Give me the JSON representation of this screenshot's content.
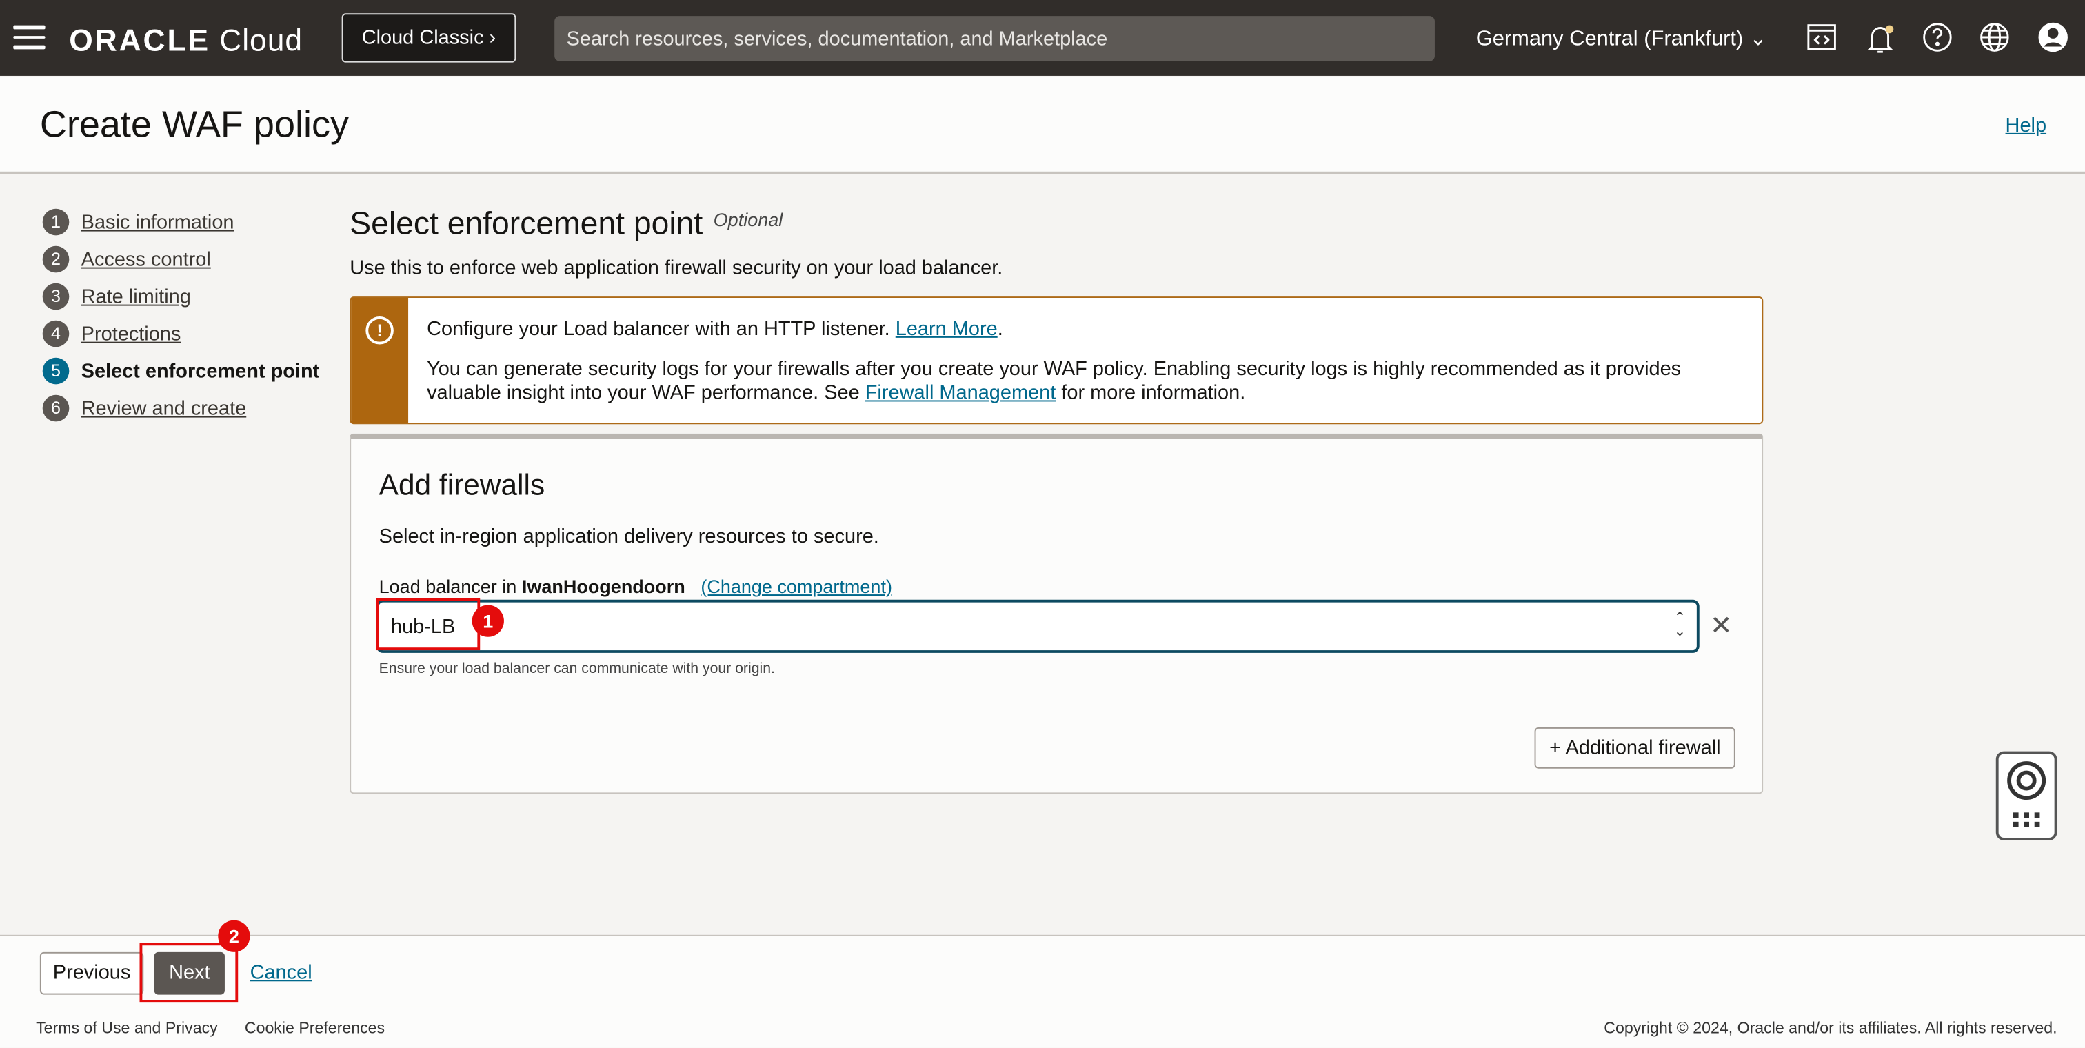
{
  "header": {
    "logo_text": "ORACLE",
    "logo_cloud": "Cloud",
    "classic_button": "Cloud Classic ›",
    "search_placeholder": "Search resources, services, documentation, and Marketplace",
    "region": "Germany Central (Frankfurt)"
  },
  "page": {
    "title": "Create WAF policy",
    "help": "Help"
  },
  "steps": [
    {
      "num": "1",
      "label": "Basic information"
    },
    {
      "num": "2",
      "label": "Access control"
    },
    {
      "num": "3",
      "label": "Rate limiting"
    },
    {
      "num": "4",
      "label": "Protections"
    },
    {
      "num": "5",
      "label": "Select enforcement point"
    },
    {
      "num": "6",
      "label": "Review and create"
    }
  ],
  "section": {
    "title": "Select enforcement point",
    "optional": "Optional",
    "description": "Use this to enforce web application firewall security on your load balancer."
  },
  "alert": {
    "line1": "Configure your Load balancer with an HTTP listener.",
    "learn_more": "Learn More",
    "line2a": "You can generate security logs for your firewalls after you create your WAF policy. Enabling security logs is highly recommended as it provides valuable insight into your WAF performance. See",
    "firewall_link": "Firewall Management",
    "line2b": "for more information."
  },
  "card": {
    "title": "Add firewalls",
    "description": "Select in-region application delivery resources to secure.",
    "lb_label": "Load balancer in",
    "compartment": "IwanHoogendoorn",
    "change_compartment": "(Change compartment)",
    "selected": "hub-LB",
    "hint": "Ensure your load balancer can communicate with your origin.",
    "add_button": "+ Additional firewall"
  },
  "annotations": {
    "badge1": "1",
    "badge2": "2"
  },
  "actions": {
    "previous": "Previous",
    "next": "Next",
    "cancel": "Cancel"
  },
  "footer": {
    "terms": "Terms of Use and Privacy",
    "cookies": "Cookie Preferences",
    "copyright": "Copyright © 2024, Oracle and/or its affiliates. All rights reserved."
  }
}
